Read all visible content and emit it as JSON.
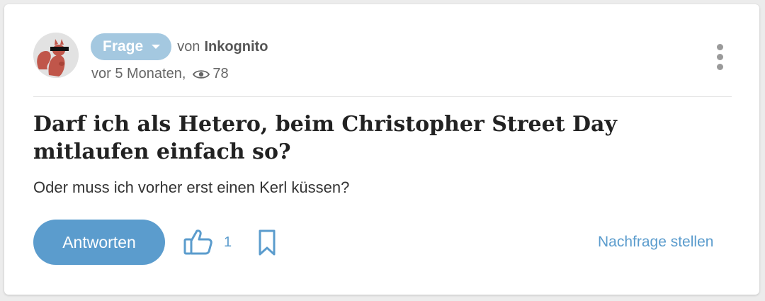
{
  "question": {
    "type_label": "Frage",
    "by_prefix": "von",
    "author": "Inkognito",
    "age": "vor 5 Monaten,",
    "views": "78",
    "title": "Darf ich als Hetero, beim Christopher Street Day mitlaufen einfach so?",
    "body": "Oder muss ich vorher erst einen Kerl küssen?"
  },
  "actions": {
    "answer_label": "Antworten",
    "like_count": "1",
    "followup_label": "Nachfrage stellen"
  },
  "icons": {
    "avatar": "anonymous-squirrel-avatar",
    "type_dropdown": "chevron-down-icon",
    "views": "eye-icon",
    "more": "more-vertical-icon",
    "like": "thumbs-up-icon",
    "bookmark": "bookmark-icon"
  },
  "colors": {
    "accent": "#5b9ccd",
    "pill": "#a4c8e0",
    "text": "#222222"
  }
}
